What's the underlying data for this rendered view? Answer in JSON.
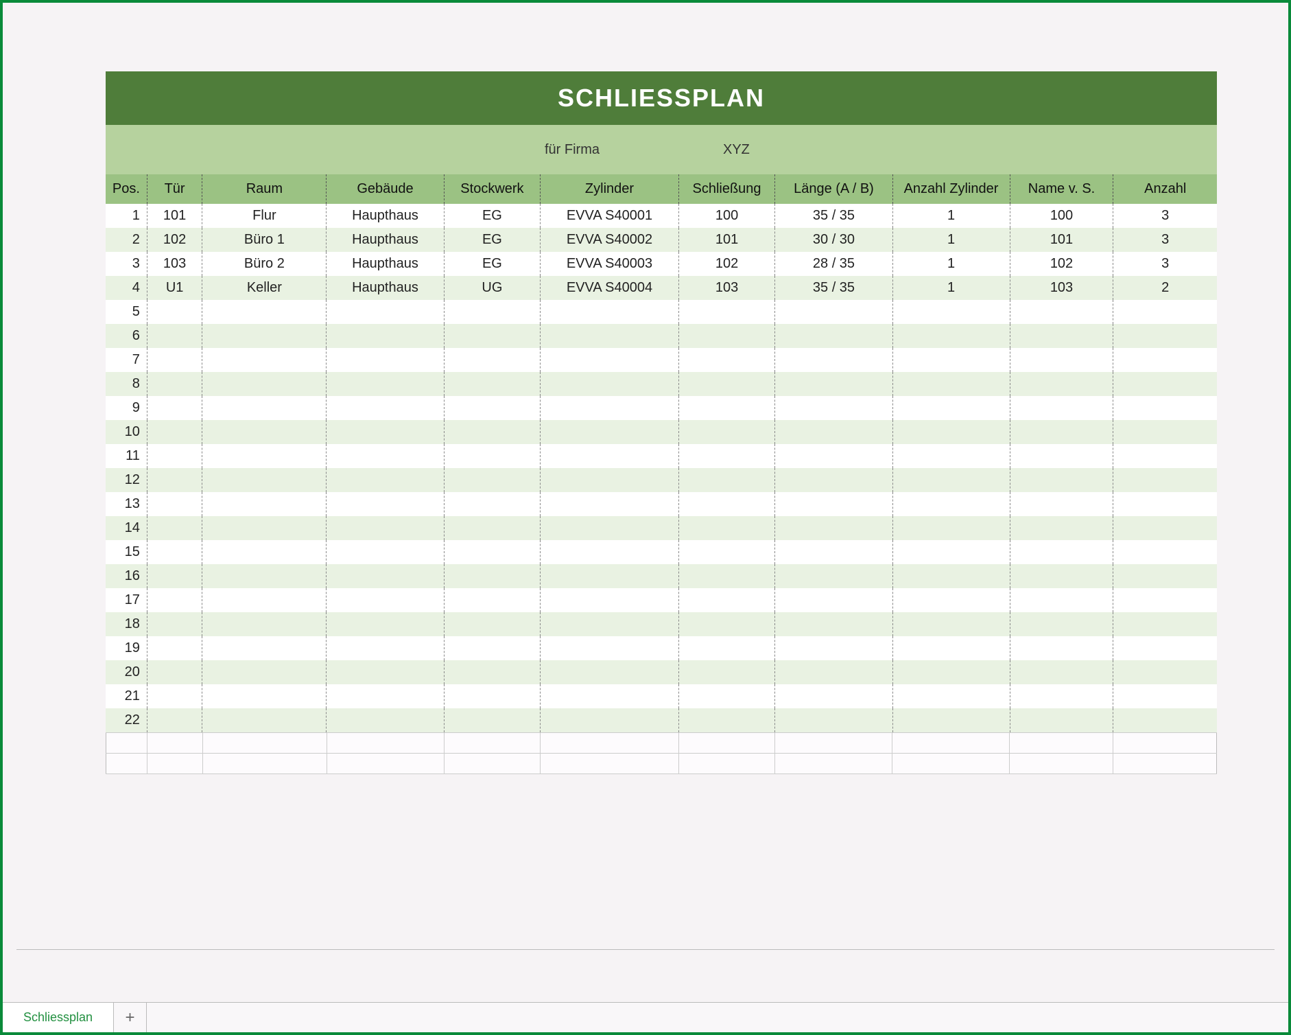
{
  "title": "SCHLIESSPLAN",
  "subtitle": {
    "label": "für Firma",
    "value": "XYZ"
  },
  "columns": [
    "Pos.",
    "Tür",
    "Raum",
    "Gebäude",
    "Stockwerk",
    "Zylinder",
    "Schließung",
    "Länge (A / B)",
    "Anzahl Zylinder",
    "Name v. S.",
    "Anzahl"
  ],
  "rows": [
    {
      "pos": "1",
      "tuer": "101",
      "raum": "Flur",
      "geb": "Haupthaus",
      "stock": "EG",
      "zyl": "EVVA S40001",
      "schl": "100",
      "laenge": "35 / 35",
      "anzzyl": "1",
      "name": "100",
      "anz": "3"
    },
    {
      "pos": "2",
      "tuer": "102",
      "raum": "Büro 1",
      "geb": "Haupthaus",
      "stock": "EG",
      "zyl": "EVVA S40002",
      "schl": "101",
      "laenge": "30 / 30",
      "anzzyl": "1",
      "name": "101",
      "anz": "3"
    },
    {
      "pos": "3",
      "tuer": "103",
      "raum": "Büro 2",
      "geb": "Haupthaus",
      "stock": "EG",
      "zyl": "EVVA S40003",
      "schl": "102",
      "laenge": "28 / 35",
      "anzzyl": "1",
      "name": "102",
      "anz": "3"
    },
    {
      "pos": "4",
      "tuer": "U1",
      "raum": "Keller",
      "geb": "Haupthaus",
      "stock": "UG",
      "zyl": "EVVA S40004",
      "schl": "103",
      "laenge": "35 / 35",
      "anzzyl": "1",
      "name": "103",
      "anz": "2"
    },
    {
      "pos": "5",
      "tuer": "",
      "raum": "",
      "geb": "",
      "stock": "",
      "zyl": "",
      "schl": "",
      "laenge": "",
      "anzzyl": "",
      "name": "",
      "anz": ""
    },
    {
      "pos": "6",
      "tuer": "",
      "raum": "",
      "geb": "",
      "stock": "",
      "zyl": "",
      "schl": "",
      "laenge": "",
      "anzzyl": "",
      "name": "",
      "anz": ""
    },
    {
      "pos": "7",
      "tuer": "",
      "raum": "",
      "geb": "",
      "stock": "",
      "zyl": "",
      "schl": "",
      "laenge": "",
      "anzzyl": "",
      "name": "",
      "anz": ""
    },
    {
      "pos": "8",
      "tuer": "",
      "raum": "",
      "geb": "",
      "stock": "",
      "zyl": "",
      "schl": "",
      "laenge": "",
      "anzzyl": "",
      "name": "",
      "anz": ""
    },
    {
      "pos": "9",
      "tuer": "",
      "raum": "",
      "geb": "",
      "stock": "",
      "zyl": "",
      "schl": "",
      "laenge": "",
      "anzzyl": "",
      "name": "",
      "anz": ""
    },
    {
      "pos": "10",
      "tuer": "",
      "raum": "",
      "geb": "",
      "stock": "",
      "zyl": "",
      "schl": "",
      "laenge": "",
      "anzzyl": "",
      "name": "",
      "anz": ""
    },
    {
      "pos": "11",
      "tuer": "",
      "raum": "",
      "geb": "",
      "stock": "",
      "zyl": "",
      "schl": "",
      "laenge": "",
      "anzzyl": "",
      "name": "",
      "anz": ""
    },
    {
      "pos": "12",
      "tuer": "",
      "raum": "",
      "geb": "",
      "stock": "",
      "zyl": "",
      "schl": "",
      "laenge": "",
      "anzzyl": "",
      "name": "",
      "anz": ""
    },
    {
      "pos": "13",
      "tuer": "",
      "raum": "",
      "geb": "",
      "stock": "",
      "zyl": "",
      "schl": "",
      "laenge": "",
      "anzzyl": "",
      "name": "",
      "anz": ""
    },
    {
      "pos": "14",
      "tuer": "",
      "raum": "",
      "geb": "",
      "stock": "",
      "zyl": "",
      "schl": "",
      "laenge": "",
      "anzzyl": "",
      "name": "",
      "anz": ""
    },
    {
      "pos": "15",
      "tuer": "",
      "raum": "",
      "geb": "",
      "stock": "",
      "zyl": "",
      "schl": "",
      "laenge": "",
      "anzzyl": "",
      "name": "",
      "anz": ""
    },
    {
      "pos": "16",
      "tuer": "",
      "raum": "",
      "geb": "",
      "stock": "",
      "zyl": "",
      "schl": "",
      "laenge": "",
      "anzzyl": "",
      "name": "",
      "anz": ""
    },
    {
      "pos": "17",
      "tuer": "",
      "raum": "",
      "geb": "",
      "stock": "",
      "zyl": "",
      "schl": "",
      "laenge": "",
      "anzzyl": "",
      "name": "",
      "anz": ""
    },
    {
      "pos": "18",
      "tuer": "",
      "raum": "",
      "geb": "",
      "stock": "",
      "zyl": "",
      "schl": "",
      "laenge": "",
      "anzzyl": "",
      "name": "",
      "anz": ""
    },
    {
      "pos": "19",
      "tuer": "",
      "raum": "",
      "geb": "",
      "stock": "",
      "zyl": "",
      "schl": "",
      "laenge": "",
      "anzzyl": "",
      "name": "",
      "anz": ""
    },
    {
      "pos": "20",
      "tuer": "",
      "raum": "",
      "geb": "",
      "stock": "",
      "zyl": "",
      "schl": "",
      "laenge": "",
      "anzzyl": "",
      "name": "",
      "anz": ""
    },
    {
      "pos": "21",
      "tuer": "",
      "raum": "",
      "geb": "",
      "stock": "",
      "zyl": "",
      "schl": "",
      "laenge": "",
      "anzzyl": "",
      "name": "",
      "anz": ""
    },
    {
      "pos": "22",
      "tuer": "",
      "raum": "",
      "geb": "",
      "stock": "",
      "zyl": "",
      "schl": "",
      "laenge": "",
      "anzzyl": "",
      "name": "",
      "anz": ""
    }
  ],
  "tabs": {
    "active": "Schliessplan",
    "add": "+"
  }
}
